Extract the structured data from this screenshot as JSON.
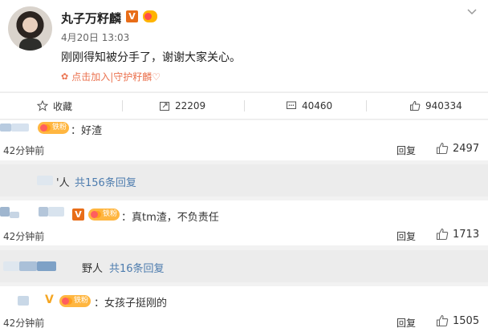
{
  "post": {
    "username": "丸子万籽麟",
    "verified_mark": "V",
    "date": "4月20日 13:03",
    "text": "刚刚得知被分手了，谢谢大家关心。",
    "join_text": "点击加入|守护籽麟♡",
    "close_icon": "chevron-down-icon"
  },
  "actions": {
    "favorite_label": "收藏",
    "repost_count": "22209",
    "comment_count": "40460",
    "like_count": "940334"
  },
  "comments": [
    {
      "text": "：好渣",
      "fan_badge": "铁粉",
      "time": "42分钟前",
      "reply_label": "回复",
      "likes": "2497"
    },
    {
      "text": "：真tm渣，不负责任",
      "verified_mark": "V",
      "fan_badge": "铁粉",
      "time": "42分钟前",
      "reply_label": "回复",
      "likes": "1713"
    },
    {
      "text": "：女孩子挺刚的",
      "verified_mark": "V",
      "fan_badge": "铁粉",
      "time": "42分钟前",
      "reply_label": "回复",
      "likes": "1505"
    }
  ],
  "reply_summaries": [
    {
      "prefix": "'人",
      "link": "共156条回复"
    },
    {
      "prefix": "野人",
      "link": "共16条回复"
    }
  ],
  "colors": {
    "accent_orange": "#eb7350",
    "link_blue": "#4d7cae",
    "verified_orange": "#e86d18"
  }
}
